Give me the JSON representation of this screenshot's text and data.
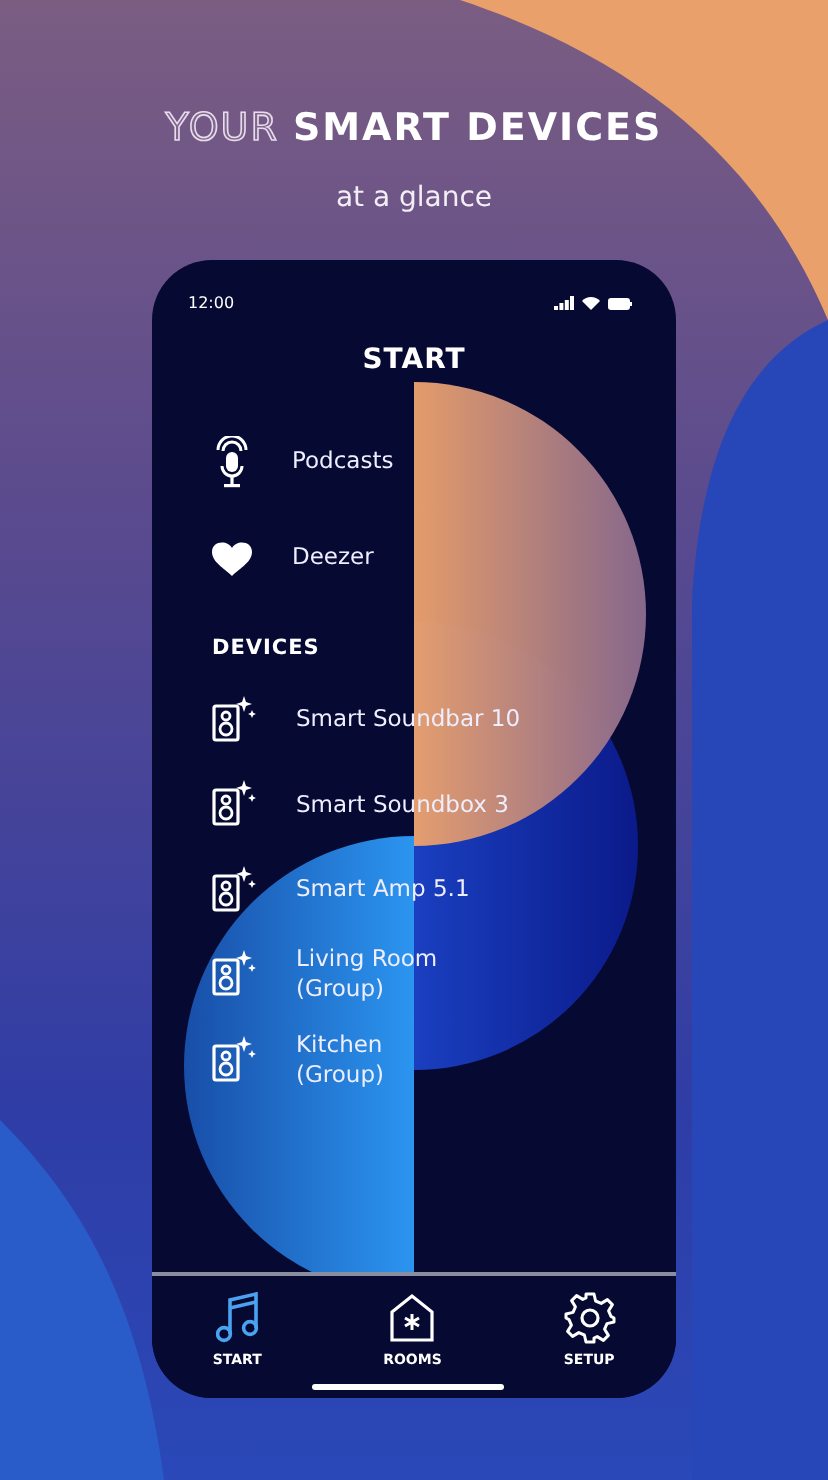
{
  "headline": "YOUR **SMART DEVICES**",
  "subtitle": "at a glance",
  "phone": {
    "status_bar": {
      "time": "12:00"
    },
    "title": "START",
    "sources": [
      {
        "label": "Podcasts",
        "kind": "podcast"
      },
      {
        "label": "Deezer",
        "kind": "heart"
      }
    ],
    "devices_heading": "DEVICES",
    "devices": [
      {
        "name": "Smart Soundbar 10"
      },
      {
        "name": "Smart Soundbox 3"
      },
      {
        "name": "Smart Amp 5.1"
      },
      {
        "name": "Living Room\n(Group)"
      },
      {
        "name": "Kitchen\n(Group)"
      }
    ],
    "tabs": [
      {
        "label": "START",
        "kind": "music",
        "selected": true
      },
      {
        "label": "ROOMS",
        "kind": "rooms",
        "selected": false
      },
      {
        "label": "SETUP",
        "kind": "settings",
        "selected": false
      }
    ]
  }
}
